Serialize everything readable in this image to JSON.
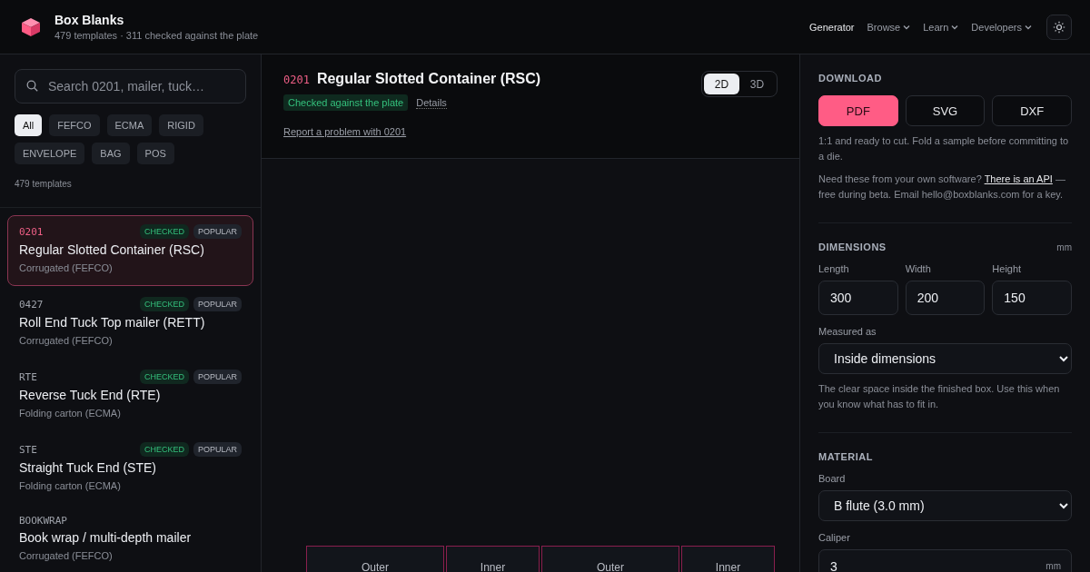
{
  "brand": {
    "title": "Box Blanks",
    "subtitle": "479 templates · 311 checked against the plate"
  },
  "nav": [
    {
      "label": "Generator",
      "selected": true,
      "dropdown": false
    },
    {
      "label": "Browse",
      "selected": false,
      "dropdown": true
    },
    {
      "label": "Learn",
      "selected": false,
      "dropdown": true
    },
    {
      "label": "Developers",
      "selected": false,
      "dropdown": true
    }
  ],
  "sidebar": {
    "search": {
      "placeholder": "Search 0201, mailer, tuck…"
    },
    "filters": [
      {
        "label": "All",
        "selected": true
      },
      {
        "label": "FEFCO",
        "selected": false
      },
      {
        "label": "ECMA",
        "selected": false
      },
      {
        "label": "RIGID",
        "selected": false
      },
      {
        "label": "ENVELOPE",
        "selected": false
      },
      {
        "label": "BAG",
        "selected": false
      },
      {
        "label": "POS",
        "selected": false
      }
    ],
    "count": "479 templates",
    "items": [
      {
        "code": "0201",
        "name": "Regular Slotted Container (RSC)",
        "category": "Corrugated (FEFCO)",
        "selected": true,
        "badges": [
          "CHECKED",
          "POPULAR"
        ]
      },
      {
        "code": "0427",
        "name": "Roll End Tuck Top mailer (RETT)",
        "category": "Corrugated (FEFCO)",
        "selected": false,
        "badges": [
          "CHECKED",
          "POPULAR"
        ]
      },
      {
        "code": "RTE",
        "name": "Reverse Tuck End (RTE)",
        "category": "Folding carton (ECMA)",
        "selected": false,
        "badges": [
          "CHECKED",
          "POPULAR"
        ]
      },
      {
        "code": "STE",
        "name": "Straight Tuck End (STE)",
        "category": "Folding carton (ECMA)",
        "selected": false,
        "badges": [
          "CHECKED",
          "POPULAR"
        ]
      },
      {
        "code": "BOOKWRAP",
        "name": "Book wrap / multi-depth mailer",
        "category": "Corrugated (FEFCO)",
        "selected": false
      }
    ]
  },
  "template": {
    "code": "0201",
    "title": "Regular Slotted Container (RSC)",
    "status": "Checked against the plate",
    "details": "Details",
    "report": "Report a problem with 0201",
    "views": [
      {
        "label": "2D",
        "selected": true
      },
      {
        "label": "3D",
        "selected": false
      }
    ],
    "panels": [
      "Outer",
      "Inner",
      "Outer",
      "Inner"
    ]
  },
  "download": {
    "heading": "DOWNLOAD",
    "formats": [
      {
        "label": "PDF",
        "selected": true
      },
      {
        "label": "SVG",
        "selected": false
      },
      {
        "label": "DXF",
        "selected": false
      }
    ],
    "note": "1:1 and ready to cut. Fold a sample before committing to a die.",
    "api_before": "Need these from your own software?",
    "api_link": "There is an API",
    "api_after": "— free during beta. Email hello@boxblanks.com for a key."
  },
  "dimensions": {
    "heading": "DIMENSIONS",
    "unit": "mm",
    "fields": [
      {
        "label": "Length",
        "value": "300"
      },
      {
        "label": "Width",
        "value": "200"
      },
      {
        "label": "Height",
        "value": "150"
      }
    ],
    "measured_label": "Measured as",
    "measured_value": "Inside dimensions",
    "measured_note": "The clear space inside the finished box. Use this when you know what has to fit in."
  },
  "material": {
    "heading": "MATERIAL",
    "board_label": "Board",
    "board_value": "B flute (3.0 mm)",
    "caliper_label": "Caliper",
    "caliper_value": "3",
    "caliper_unit": "mm"
  }
}
